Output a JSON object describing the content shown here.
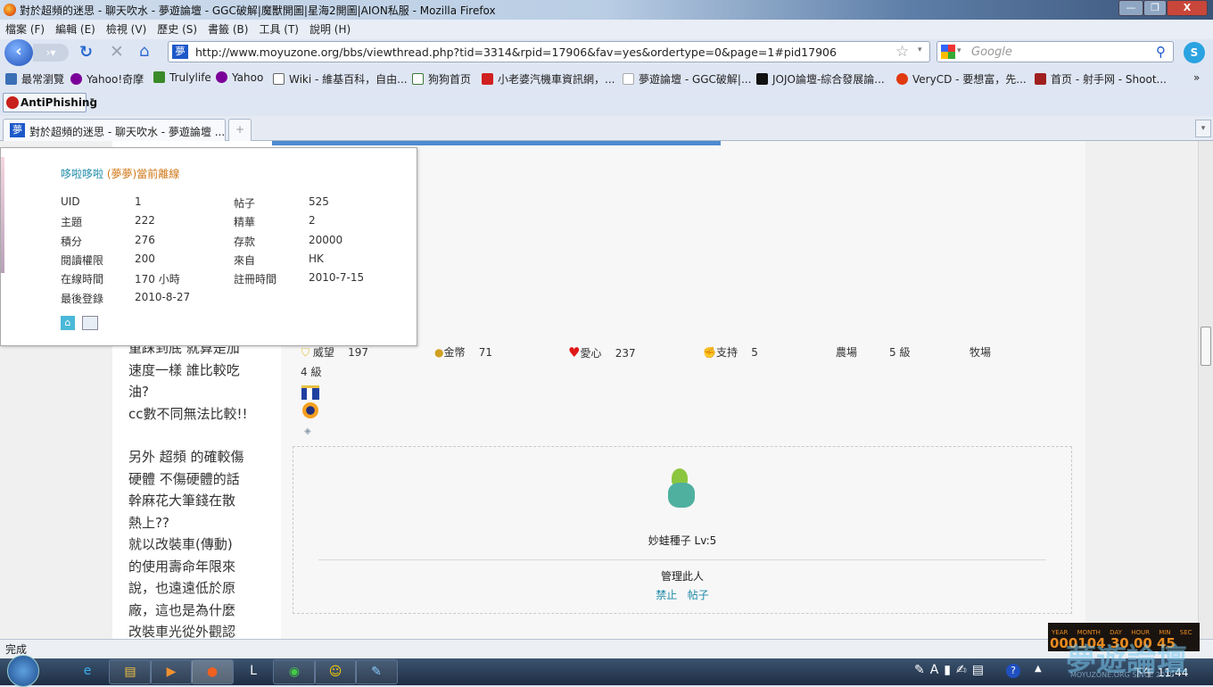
{
  "window": {
    "title": "對於超頻的迷思 - 聊天吹水 - 夢遊論壇 - GGC破解|魔獸開圖|星海2開圖|AION私服 - Mozilla Firefox",
    "minimize": "—",
    "restore": "❐",
    "close": "X"
  },
  "menu": [
    "檔案 (F)",
    "編輯 (E)",
    "檢視 (V)",
    "歷史 (S)",
    "書籤 (B)",
    "工具 (T)",
    "說明 (H)"
  ],
  "nav": {
    "url": "http://www.moyuzone.org/bbs/viewthread.php?tid=3314&rpid=17906&fav=yes&ordertype=0&page=1#pid17906",
    "search_placeholder": "Google",
    "site_icon": "夢"
  },
  "bookmarks": [
    {
      "label": "最常瀏覽",
      "color": "#3b6fb6"
    },
    {
      "label": "Yahoo!奇摩",
      "color": "#7b0099"
    },
    {
      "label": "Trulylife",
      "color": "#3a8a2a"
    },
    {
      "label": "Yahoo",
      "color": "#7b0099"
    },
    {
      "label": "Wiki - 維基百科，自由...",
      "color": "#444"
    },
    {
      "label": "狗狗首页",
      "color": "#3a7a3a"
    },
    {
      "label": "小老婆汽機車資訊網，...",
      "color": "#d02020"
    },
    {
      "label": "夢遊論壇 - GGC破解|...",
      "color": "#ddd"
    },
    {
      "label": "JOJO論壇-綜合發展論...",
      "color": "#111"
    },
    {
      "label": "VeryCD - 要想富，先...",
      "color": "#e03a10"
    },
    {
      "label": "首页 - 射手网 - Shoot...",
      "color": "#a02020"
    }
  ],
  "bookmarks_more": "»",
  "antiphishing": "AntiPhishing",
  "tab": {
    "label": "對於超頻的迷思 - 聊天吹水 - 夢遊論壇 ...",
    "new_tab": "+"
  },
  "profile": {
    "name": "哆啦哆啦",
    "status": "(夢夢)當前離線",
    "fields": [
      [
        "UID",
        "1",
        "帖子",
        "525"
      ],
      [
        "主題",
        "222",
        "精華",
        "2"
      ],
      [
        "積分",
        "276",
        "存款",
        "20000"
      ],
      [
        "閱讀權限",
        "200",
        "來自",
        "HK"
      ],
      [
        "在線時間",
        "170 小時",
        "註冊時間",
        "2010-7-15"
      ],
      [
        "最後登錄",
        "2010-8-27",
        "",
        ""
      ]
    ]
  },
  "post_lines": [
    "重踩到底 就算是加",
    "速度一樣 誰比較吃",
    "油?",
    "cc數不同無法比較!!",
    "",
    "另外 超頻 的確較傷",
    "硬體 不傷硬體的話",
    "幹麻花大筆錢在散",
    "熱上??",
    "就以改裝車(傳動)",
    "的使用壽命年限來",
    "說，也遠遠低於原",
    "廠，這也是為什麼",
    "改裝車光從外觀認"
  ],
  "stats": [
    {
      "label": "威望",
      "value": "197"
    },
    {
      "label": "金幣",
      "value": "71"
    },
    {
      "label": "愛心",
      "value": "237"
    },
    {
      "label": "支持",
      "value": "5"
    },
    {
      "label": "農場",
      "value": "5 級"
    },
    {
      "label": "牧場",
      "value": "4 級"
    }
  ],
  "pet": {
    "name": "妙蛙種子 Lv:5",
    "manage": "管理此人",
    "ban": "禁止",
    "posts": "帖子"
  },
  "status": "完成",
  "clock": {
    "labels": [
      "YEAR",
      "MONTH",
      "DAY",
      "HOUR",
      "MIN",
      "SEC"
    ],
    "digits": "000104 30 00 45",
    "time": "下午 11:44"
  },
  "watermark": "夢遊論壇",
  "watermark_sub": "MOYUZONE.ORG SINCE 2010"
}
